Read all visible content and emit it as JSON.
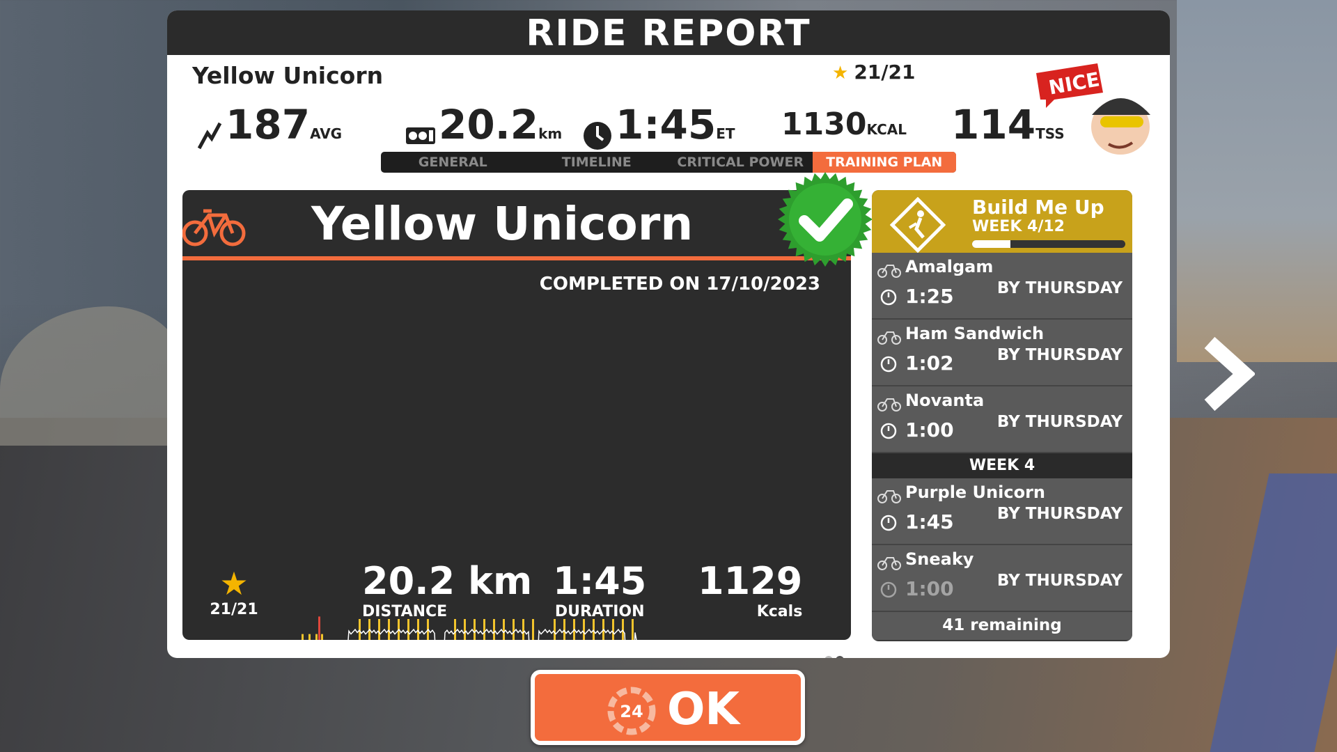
{
  "dialog": {
    "title": "RIDE REPORT"
  },
  "summary": {
    "rider_name": "Yellow Unicorn",
    "stars": "21/21",
    "avg_power": "187",
    "avg_power_unit": "AVG",
    "distance": "20.2",
    "distance_unit": "km",
    "time": "1:45",
    "time_unit": "ET",
    "calories": "1130",
    "calories_unit": "KCAL",
    "tss": "114",
    "tss_unit": "TSS",
    "badge": "NICE!"
  },
  "tabs": [
    {
      "label": "GENERAL"
    },
    {
      "label": "TIMELINE"
    },
    {
      "label": "CRITICAL POWER"
    },
    {
      "label": "TRAINING PLAN",
      "active": true
    }
  ],
  "workout_card": {
    "title": "Yellow Unicorn",
    "completed": "COMPLETED ON 17/10/2023",
    "stars": "21/21",
    "distance_value": "20.2 km",
    "distance_label": "DISTANCE",
    "duration_value": "1:45",
    "duration_label": "DURATION",
    "kcal_value": "1129",
    "kcal_label": "Kcals"
  },
  "plan": {
    "name": "Build Me Up",
    "week": "WEEK 4/12",
    "progress": 0.25,
    "workouts": [
      {
        "name": "Amalgam",
        "time": "1:25",
        "due": "BY THURSDAY"
      },
      {
        "name": "Ham Sandwich",
        "time": "1:02",
        "due": "BY THURSDAY"
      },
      {
        "name": "Novanta",
        "time": "1:00",
        "due": "BY THURSDAY"
      }
    ],
    "week_separator": "WEEK 4",
    "workouts_next": [
      {
        "name": "Purple Unicorn",
        "time": "1:45",
        "due": "BY THURSDAY"
      },
      {
        "name": "Sneaky",
        "time": "1:00",
        "due": "BY THURSDAY"
      }
    ],
    "remaining": "41 remaining"
  },
  "ok_button": {
    "label": "OK",
    "icon_text": "24"
  },
  "colors": {
    "accent": "#f36c3d",
    "plan_gold": "#c8a21b",
    "zone_grey": "#808080",
    "zone_blue": "#3a8cf0",
    "zone_green": "#4db84d",
    "zone_yellow": "#f2c42c",
    "zone_red": "#e0473c"
  }
}
